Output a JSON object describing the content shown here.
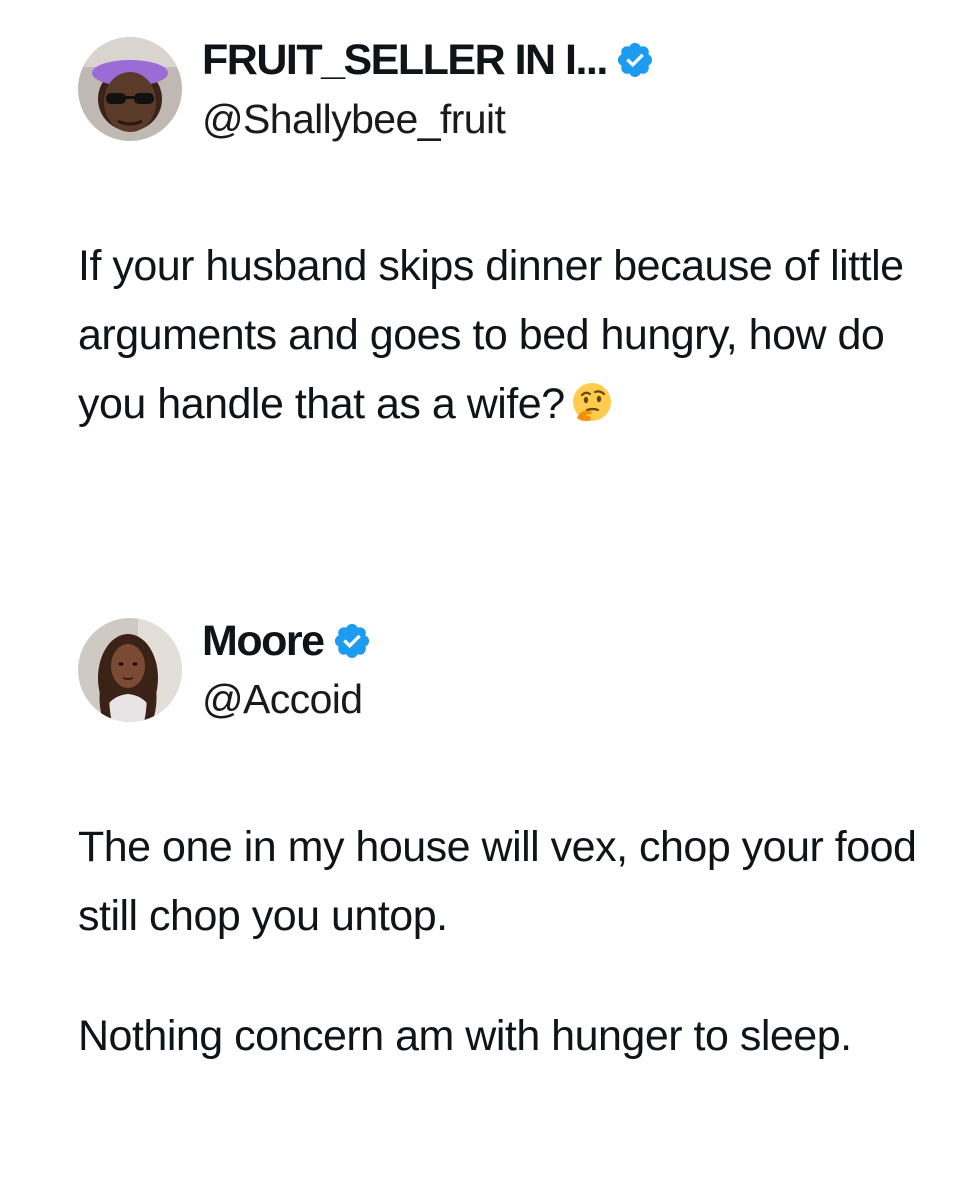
{
  "tweets": [
    {
      "display_name": "FRUIT_SELLER IN I...",
      "handle": "@Shallybee_fruit",
      "verified": true,
      "avatar_icon": "profile-photo-woman-headband-sunglasses",
      "paragraphs": [
        "If your husband skips dinner because of little arguments and goes to bed hungry, how do you handle that as a wife?"
      ],
      "trailing_emoji": "thinking-face-icon"
    },
    {
      "display_name": "Moore",
      "handle": "@Accoid",
      "verified": true,
      "avatar_icon": "profile-photo-woman-long-hair",
      "paragraphs": [
        "The one in my house will vex, chop your food still chop you untop.",
        "Nothing concern am with hunger to sleep."
      ]
    }
  ],
  "colors": {
    "verified_badge": "#1d9bf0",
    "text": "#0f1419",
    "background": "#ffffff"
  }
}
